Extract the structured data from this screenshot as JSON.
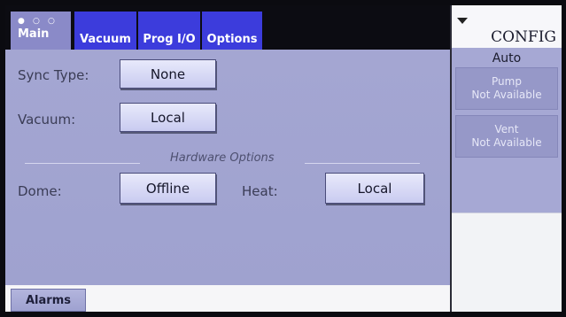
{
  "tabs": {
    "main": "Main",
    "vacuum": "Vacuum",
    "prog_io": "Prog I/O",
    "options": "Options"
  },
  "sync_type": {
    "label": "Sync Type:",
    "value": "None"
  },
  "vacuum": {
    "label": "Vacuum:",
    "value": "Local"
  },
  "hardware_options": {
    "title": "Hardware Options",
    "dome_label": "Dome:",
    "dome_value": "Offline",
    "heat_label": "Heat:",
    "heat_value": "Local"
  },
  "footer": {
    "alarms": "Alarms"
  },
  "side": {
    "title": "CONFIG",
    "mode": "Auto",
    "pump": {
      "label": "Pump",
      "status": "Not Available"
    },
    "vent": {
      "label": "Vent",
      "status": "Not Available"
    }
  }
}
